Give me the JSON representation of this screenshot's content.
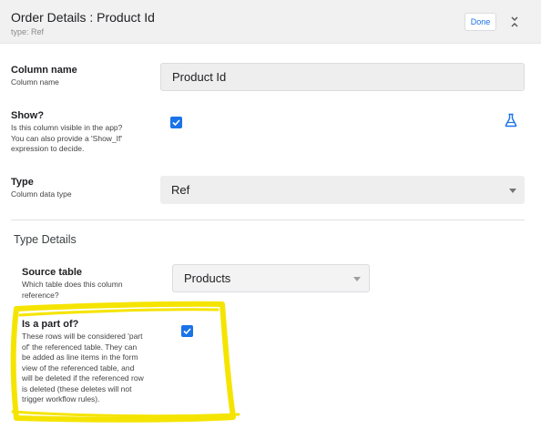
{
  "header": {
    "title": "Order Details : Product Id",
    "subtitle": "type: Ref",
    "done_label": "Done"
  },
  "column_name": {
    "label": "Column name",
    "description": "Column name",
    "value": "Product Id"
  },
  "show": {
    "label": "Show?",
    "description_lines": [
      "Is this column visible in the app?",
      "You can also provide a 'Show_If'",
      "expression to decide."
    ],
    "checked": true
  },
  "type": {
    "label": "Type",
    "description": "Column data type",
    "value": "Ref"
  },
  "type_details": {
    "title": "Type Details",
    "source_table": {
      "label": "Source table",
      "description_lines": [
        "Which table does this column",
        "reference?"
      ],
      "value": "Products"
    },
    "is_part_of": {
      "label": "Is a part of?",
      "description_lines": [
        "These rows will be considered 'part",
        "of' the referenced table. They can",
        "be added as line items in the form",
        "view of the referenced table, and",
        "will be deleted if the referenced row",
        "is deleted (these deletes will not",
        "trigger workflow rules)."
      ],
      "checked": true
    }
  },
  "colors": {
    "accent": "#1a73e8",
    "highlight": "#f5e400",
    "header_bg": "#f1f1f1",
    "field_bg": "#eeeeee"
  },
  "icons": {
    "collapse": "collapse-icon",
    "test_expression": "flask-icon",
    "checkmark": "check-icon"
  }
}
